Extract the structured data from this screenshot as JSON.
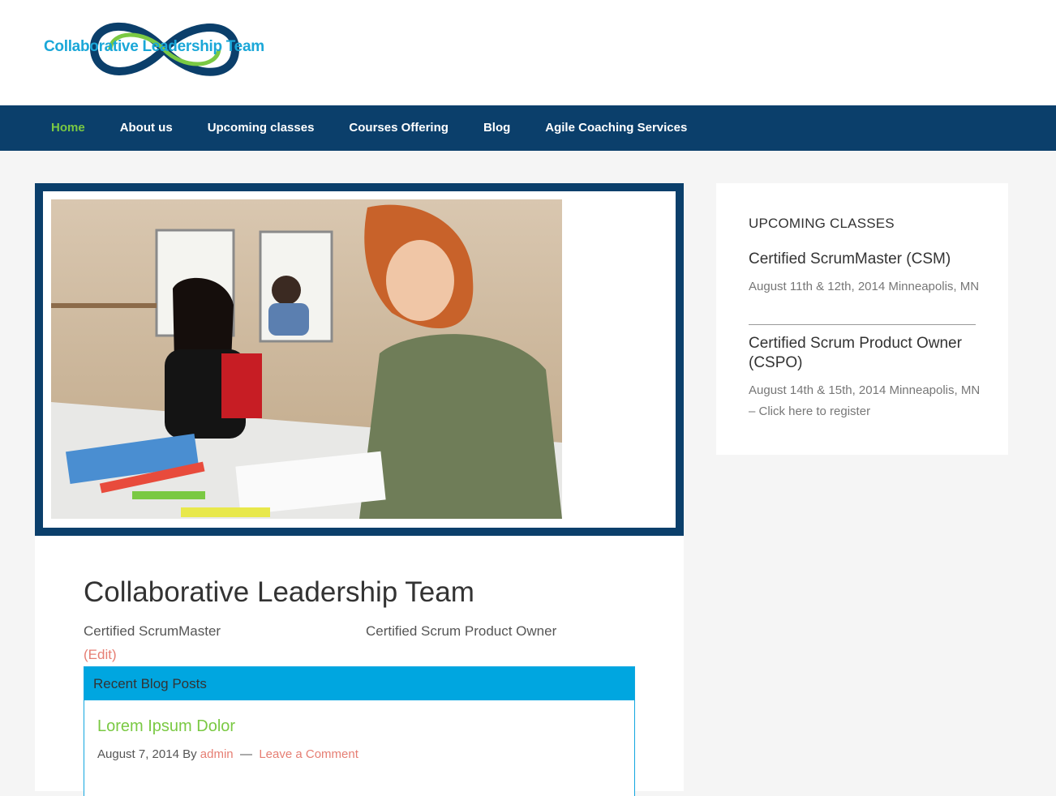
{
  "header": {
    "logo_text": "Collaborative Leadership Team",
    "brand_colors": {
      "navy": "#0b3f6b",
      "cyan": "#1aa7d8",
      "green": "#7ac943"
    }
  },
  "nav": {
    "items": [
      {
        "label": "Home",
        "active": true
      },
      {
        "label": "About us",
        "active": false
      },
      {
        "label": "Upcoming classes",
        "active": false
      },
      {
        "label": "Courses Offering",
        "active": false
      },
      {
        "label": "Blog",
        "active": false
      },
      {
        "label": "Agile Coaching Services",
        "active": false
      }
    ]
  },
  "main": {
    "title": "Collaborative Leadership Team",
    "tagline_left": "Certified ScrumMaster",
    "tagline_right": "Certified Scrum Product Owner",
    "edit_label": "(Edit)",
    "recent_posts": {
      "heading": "Recent Blog Posts",
      "posts": [
        {
          "title": "Lorem Ipsum Dolor",
          "date": "August 7, 2014",
          "by_label": "By",
          "author": "admin",
          "separator": "—",
          "comment_link": "Leave a Comment"
        }
      ]
    }
  },
  "sidebar": {
    "widget_title": "UPCOMING CLASSES",
    "classes": [
      {
        "title": "Certified ScrumMaster (CSM)",
        "details": "August 11th & 12th, 2014 Minneapolis, MN"
      },
      {
        "title": "Certified Scrum Product Owner (CSPO)",
        "details": "August 14th & 15th, 2014 Minneapolis, MN – Click here to register"
      }
    ]
  }
}
